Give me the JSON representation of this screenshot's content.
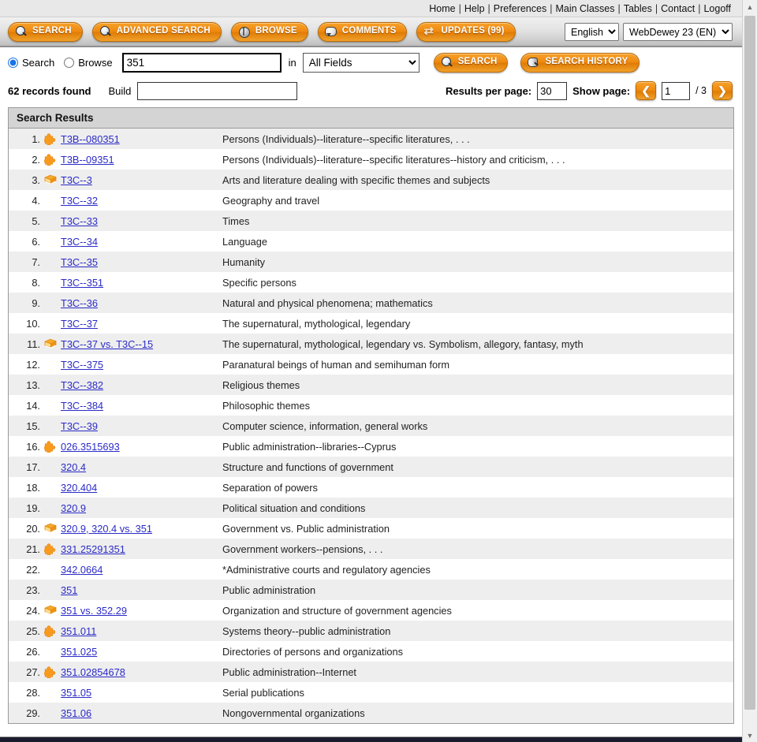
{
  "topnav": {
    "items": [
      "Home",
      "Help",
      "Preferences",
      "Main Classes",
      "Tables",
      "Contact",
      "Logoff"
    ],
    "separator": "|"
  },
  "toolbar": {
    "buttons": [
      {
        "label": "SEARCH",
        "icon": "magnifier-icon"
      },
      {
        "label": "ADVANCED SEARCH",
        "icon": "magnifier-icon"
      },
      {
        "label": "BROWSE",
        "icon": "globe-icon"
      },
      {
        "label": "COMMENTS",
        "icon": "speech-bubble-icon"
      },
      {
        "label": "UPDATES (99)",
        "icon": "refresh-icon"
      }
    ],
    "language_select": {
      "value": "English",
      "options": [
        "English"
      ]
    },
    "edition_select": {
      "value": "WebDewey 23 (EN)",
      "options": [
        "WebDewey 23 (EN)"
      ]
    }
  },
  "searchbar": {
    "mode_search_label": "Search",
    "mode_browse_label": "Browse",
    "mode_selected": "Search",
    "query_value": "351",
    "query_placeholder": "",
    "in_label": "in",
    "field_select": {
      "value": "All Fields",
      "options": [
        "All Fields"
      ]
    },
    "search_button": "SEARCH",
    "history_button": "SEARCH HISTORY"
  },
  "inforow": {
    "records_found": "62 records found",
    "build_label": "Build",
    "build_value": "",
    "results_per_page_label": "Results per page:",
    "results_per_page_value": "30",
    "show_page_label": "Show page:",
    "page_value": "1",
    "page_total": "/ 3",
    "prev_arrow": "←",
    "next_arrow": "→"
  },
  "results": {
    "header": "Search Results",
    "rows": [
      {
        "num": "1.",
        "icon": "puzzle-piece-icon",
        "link": "T3B--080351",
        "desc": "Persons (Individuals)--literature--specific literatures, . . ."
      },
      {
        "num": "2.",
        "icon": "puzzle-piece-icon",
        "link": "T3B--09351",
        "desc": "Persons (Individuals)--literature--specific literatures--history and criticism, . . ."
      },
      {
        "num": "3.",
        "icon": "book-icon",
        "link": "T3C--3",
        "desc": "Arts and literature dealing with specific themes and subjects"
      },
      {
        "num": "4.",
        "icon": "none",
        "link": "T3C--32",
        "desc": "Geography and travel"
      },
      {
        "num": "5.",
        "icon": "none",
        "link": "T3C--33",
        "desc": "Times"
      },
      {
        "num": "6.",
        "icon": "none",
        "link": "T3C--34",
        "desc": "Language"
      },
      {
        "num": "7.",
        "icon": "none",
        "link": "T3C--35",
        "desc": "Humanity"
      },
      {
        "num": "8.",
        "icon": "none",
        "link": "T3C--351",
        "desc": "Specific persons"
      },
      {
        "num": "9.",
        "icon": "none",
        "link": "T3C--36",
        "desc": "Natural and physical phenomena; mathematics"
      },
      {
        "num": "10.",
        "icon": "none",
        "link": "T3C--37",
        "desc": "The supernatural, mythological, legendary"
      },
      {
        "num": "11.",
        "icon": "book-icon",
        "link": "T3C--37 vs. T3C--15",
        "desc": "The supernatural, mythological, legendary vs. Symbolism, allegory, fantasy, myth"
      },
      {
        "num": "12.",
        "icon": "none",
        "link": "T3C--375",
        "desc": "Paranatural beings of human and semihuman form"
      },
      {
        "num": "13.",
        "icon": "none",
        "link": "T3C--382",
        "desc": "Religious themes"
      },
      {
        "num": "14.",
        "icon": "none",
        "link": "T3C--384",
        "desc": "Philosophic themes"
      },
      {
        "num": "15.",
        "icon": "none",
        "link": "T3C--39",
        "desc": "Computer science, information, general works"
      },
      {
        "num": "16.",
        "icon": "puzzle-piece-icon",
        "link": "026.3515693",
        "desc": "Public administration--libraries--Cyprus"
      },
      {
        "num": "17.",
        "icon": "none",
        "link": "320.4",
        "desc": "Structure and functions of government"
      },
      {
        "num": "18.",
        "icon": "none",
        "link": "320.404",
        "desc": "Separation of powers"
      },
      {
        "num": "19.",
        "icon": "none",
        "link": "320.9",
        "desc": "Political situation and conditions"
      },
      {
        "num": "20.",
        "icon": "book-icon",
        "link": "320.9, 320.4 vs. 351",
        "desc": "Government vs. Public administration"
      },
      {
        "num": "21.",
        "icon": "puzzle-piece-icon",
        "link": "331.25291351",
        "desc": "Government workers--pensions, . . ."
      },
      {
        "num": "22.",
        "icon": "none",
        "link": "342.0664",
        "desc": "*Administrative courts and regulatory agencies"
      },
      {
        "num": "23.",
        "icon": "none",
        "link": "351",
        "desc": "Public administration"
      },
      {
        "num": "24.",
        "icon": "book-icon",
        "link": "351 vs. 352.29",
        "desc": "Organization and structure of government agencies"
      },
      {
        "num": "25.",
        "icon": "puzzle-piece-icon",
        "link": "351.011",
        "desc": "Systems theory--public administration"
      },
      {
        "num": "26.",
        "icon": "none",
        "link": "351.025",
        "desc": "Directories of persons and organizations"
      },
      {
        "num": "27.",
        "icon": "puzzle-piece-icon",
        "link": "351.02854678",
        "desc": "Public administration--Internet"
      },
      {
        "num": "28.",
        "icon": "none",
        "link": "351.05",
        "desc": "Serial publications"
      },
      {
        "num": "29.",
        "icon": "none",
        "link": "351.06",
        "desc": "Nongovernmental organizations"
      }
    ]
  },
  "colors": {
    "accent_orange": "#ef8a0f",
    "link_blue": "#2b2bc8",
    "row_stripe": "#eeeeee",
    "panel_header": "#d4d4d4"
  }
}
